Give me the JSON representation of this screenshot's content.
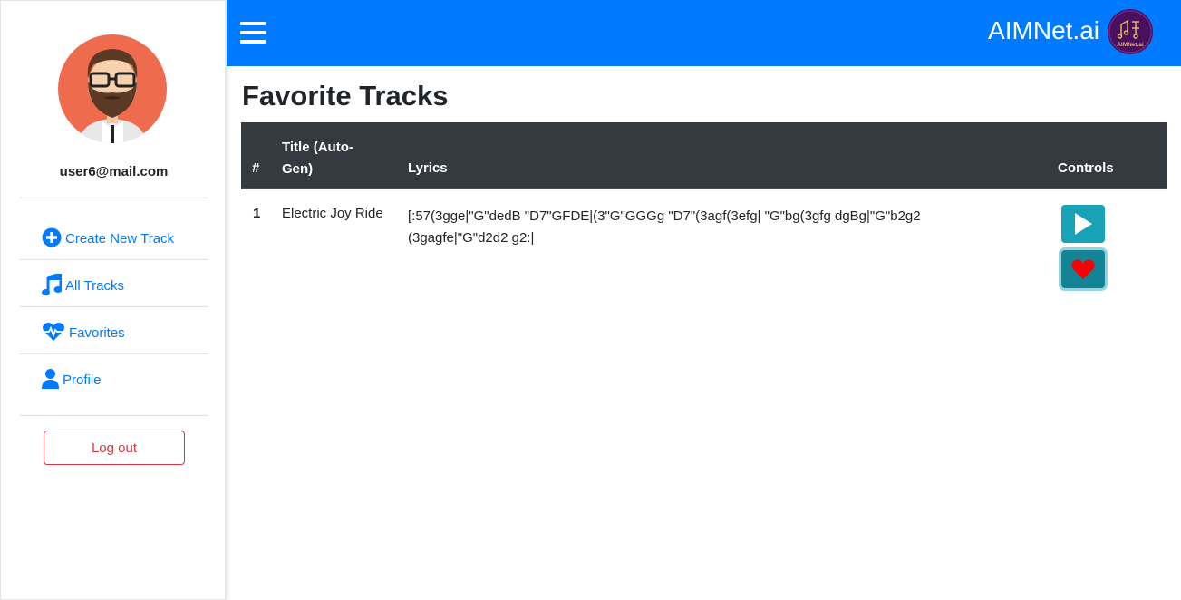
{
  "sidebar": {
    "email": "user6@mail.com",
    "nav": [
      {
        "label": "Create New Track",
        "icon": "plus-circle-icon"
      },
      {
        "label": "All Tracks",
        "icon": "music-note-icon"
      },
      {
        "label": "Favorites",
        "icon": "heartbeat-icon"
      },
      {
        "label": "Profile",
        "icon": "user-icon"
      }
    ],
    "logout_label": "Log out"
  },
  "header": {
    "brand": "AIMNet.ai",
    "logo_text": "AIMNet.ai"
  },
  "main": {
    "title": "Favorite Tracks",
    "table": {
      "columns": [
        "#",
        "Title (Auto-Gen)",
        "Lyrics",
        "Controls"
      ],
      "rows": [
        {
          "index": "1",
          "title": "Electric Joy Ride",
          "lyrics": "[:57(3gge|\"G\"dedB \"D7\"GFDE|(3\"G\"GGGg \"D7\"(3agf(3efg| \"G\"bg(3gfg dgBg|\"G\"b2g2 (3gagfe|\"G\"d2d2 g2:|"
        }
      ]
    }
  },
  "colors": {
    "primary": "#007bff",
    "info": "#17a2b8",
    "danger": "#dc3545",
    "dark": "#343a40",
    "heart": "#ff0000"
  }
}
